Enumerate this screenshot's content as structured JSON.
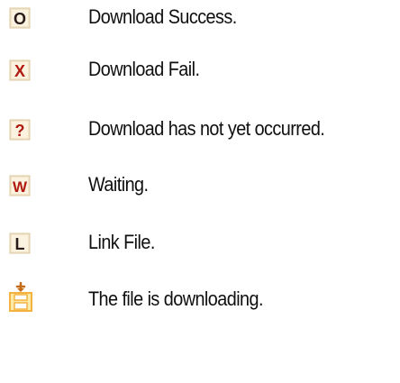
{
  "legend": {
    "items": [
      {
        "icon": "success-icon",
        "glyph": "O",
        "label": "Download Success."
      },
      {
        "icon": "fail-icon",
        "glyph": "X",
        "label": "Download Fail."
      },
      {
        "icon": "pending-icon",
        "glyph": "?",
        "label": "Download has not yet occurred."
      },
      {
        "icon": "waiting-icon",
        "glyph": "W",
        "label": "Waiting."
      },
      {
        "icon": "link-file-icon",
        "glyph": "L",
        "label": "Link File."
      },
      {
        "icon": "downloading-icon",
        "glyph": "",
        "label": "The file is downloading."
      }
    ]
  },
  "colors": {
    "icon_glyph": "#b11a10",
    "icon_glyph_dark": "#2b1b1b",
    "icon_bg": "#f3e6c8",
    "icon_border": "#d8c7a2",
    "downloading_accent": "#f4b340",
    "text": "#0f0f0f"
  }
}
